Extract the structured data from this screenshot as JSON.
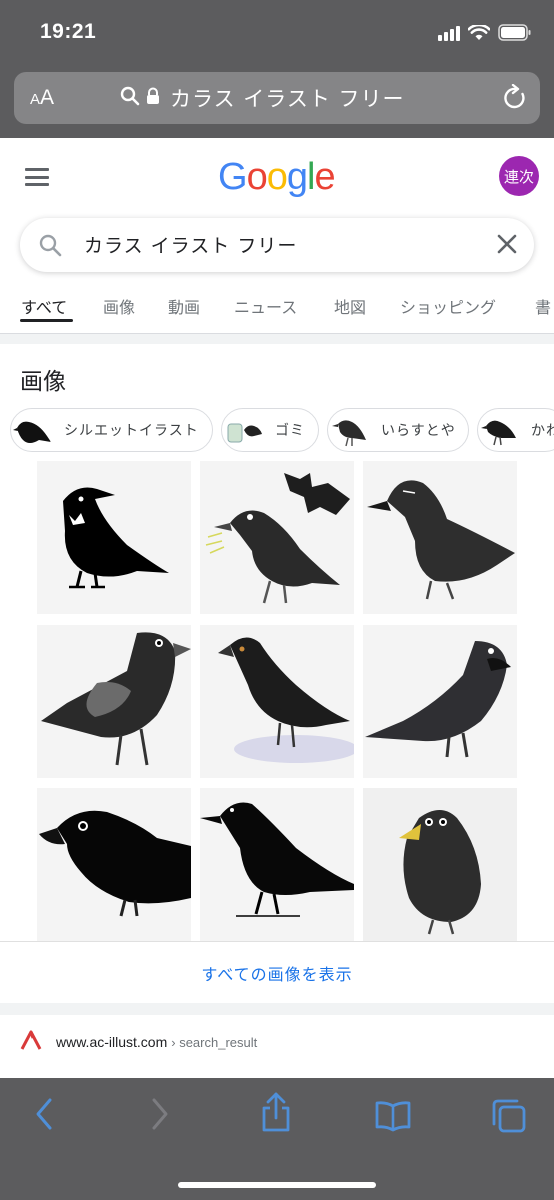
{
  "status_bar": {
    "time": "19:21"
  },
  "browser": {
    "text_size_small": "A",
    "text_size_big": "A",
    "url_display": "カラス イラスト フリー"
  },
  "google": {
    "logo_letters": [
      "G",
      "o",
      "o",
      "g",
      "l",
      "e"
    ],
    "logo_colors": [
      "#4285F4",
      "#EA4335",
      "#FBBC05",
      "#4285F4",
      "#34A853",
      "#EA4335"
    ],
    "avatar_text": "連次",
    "avatar_color": "#9c27b0"
  },
  "search": {
    "query": "カラス イラスト フリー"
  },
  "tabs": [
    {
      "label": "すべて",
      "active": true
    },
    {
      "label": "画像"
    },
    {
      "label": "動画"
    },
    {
      "label": "ニュース"
    },
    {
      "label": "地図"
    },
    {
      "label": "ショッピング"
    },
    {
      "label": "書"
    }
  ],
  "images_section": {
    "title": "画像",
    "chips": [
      {
        "label": "シルエットイラスト"
      },
      {
        "label": "ゴミ"
      },
      {
        "label": "いらすとや"
      },
      {
        "label": "かわ"
      }
    ],
    "show_all_label": "すべての画像を表示"
  },
  "result": {
    "domain": "www.ac-illust.com",
    "breadcrumb": "› search_result"
  },
  "colors": {
    "chrome_gray": "#5c5c5e",
    "link_blue": "#1a73e8",
    "toolbar_blue": "#4f8fd8"
  }
}
